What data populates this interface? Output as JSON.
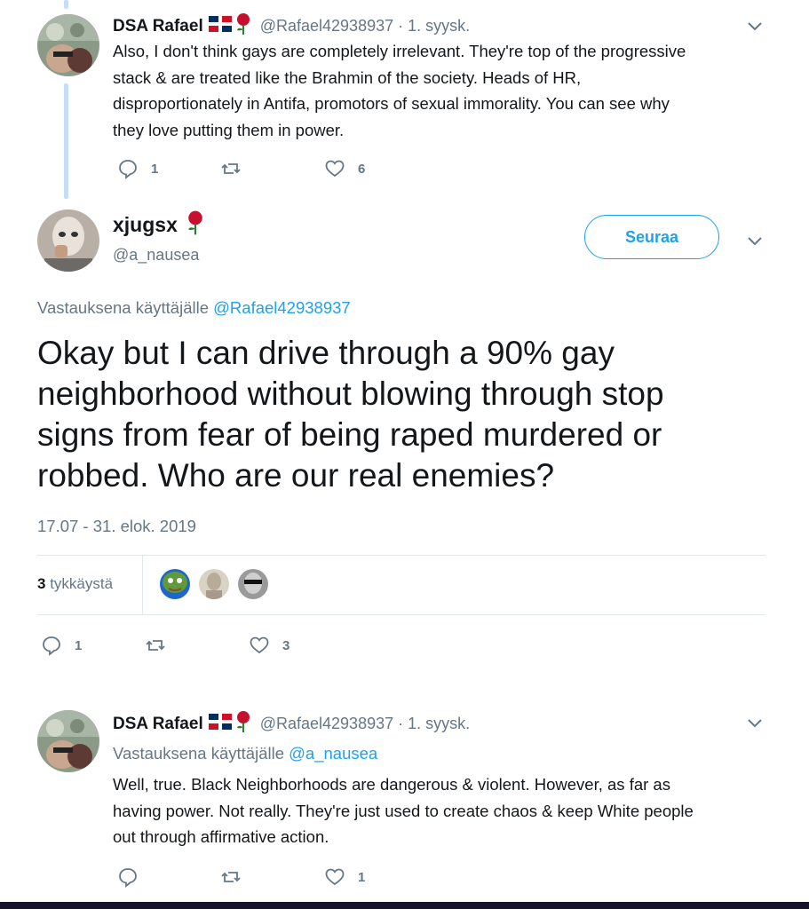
{
  "colors": {
    "accent": "#1da1f2",
    "secondary_text": "#657786",
    "thread_line": "#c4dff5",
    "divider": "#e1e8ed"
  },
  "tweet1": {
    "name": "DSA Rafael",
    "handle_date": "@Rafael42938937 · 1. syysk.",
    "text_lines": [
      "Also, I don't think gays are completely irrelevant. They're top of the progressive",
      "stack & are treated like the Brahmin of the society. Heads of HR,",
      "disproportionately in Antifa, promotors of sexual immorality. You can see why",
      "they love putting them in power."
    ],
    "replies": "1",
    "likes": "6"
  },
  "main_tweet": {
    "name": "xjugsx",
    "handle": "@a_nausea",
    "follow_label": "Seuraa",
    "reply_prefix": "Vastauksena käyttäjälle",
    "reply_mention": "@Rafael42938937",
    "text_lines": [
      "Okay but I can drive through a 90% gay",
      "neighborhood without blowing through stop",
      "signs from fear of being raped murdered or",
      "robbed. Who are our real enemies?"
    ],
    "timestamp": "17.07 - 31. elok. 2019",
    "likes_count": "3",
    "likes_label": "tykkäystä",
    "replies": "1",
    "likes": "3"
  },
  "tweet3": {
    "name": "DSA Rafael",
    "handle_date": "@Rafael42938937 · 1. syysk.",
    "reply_prefix": "Vastauksena käyttäjälle",
    "reply_mention": "@a_nausea",
    "text_lines": [
      "Well, true. Black Neighborhoods are dangerous & violent. However, as far as",
      "having power. Not really. They're just used to create chaos & keep White people",
      "out through affirmative action."
    ],
    "likes": "1"
  }
}
